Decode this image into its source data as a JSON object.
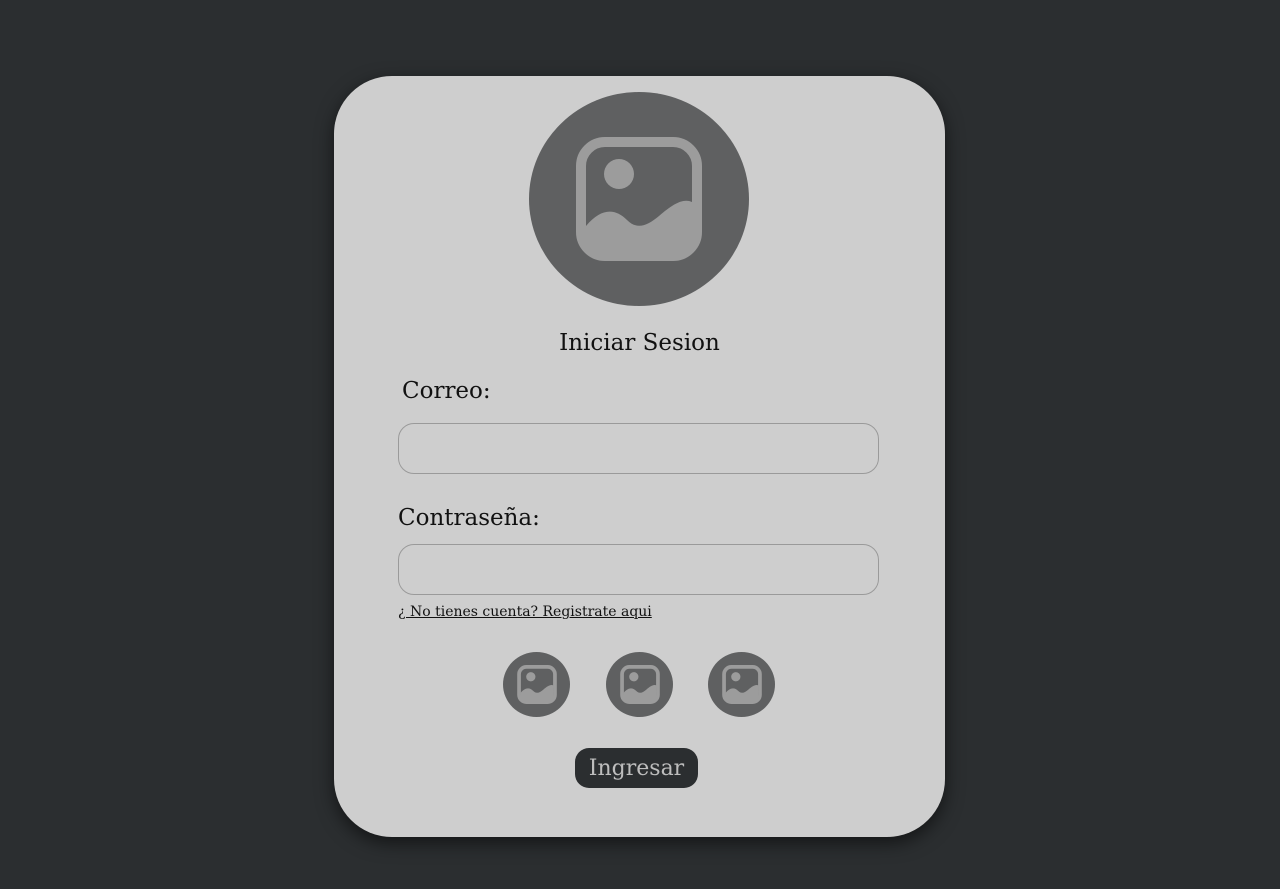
{
  "form": {
    "title": "Iniciar Sesion",
    "email_label": "Correo:",
    "email_value": "",
    "password_label": "Contraseña:",
    "password_value": "",
    "register_link": "¿ No tienes cuenta? Registrate aqui",
    "submit_label": "Ingresar"
  },
  "icons": {
    "avatar": "image-placeholder-icon",
    "social": [
      "image-placeholder-icon",
      "image-placeholder-icon",
      "image-placeholder-icon"
    ]
  },
  "colors": {
    "background": "#2b2e30",
    "card": "#cecece",
    "icon_circle": "#5f6061",
    "icon_glyph": "#9c9c9c",
    "button": "#2b2e30",
    "button_text": "#bdbdbd"
  }
}
